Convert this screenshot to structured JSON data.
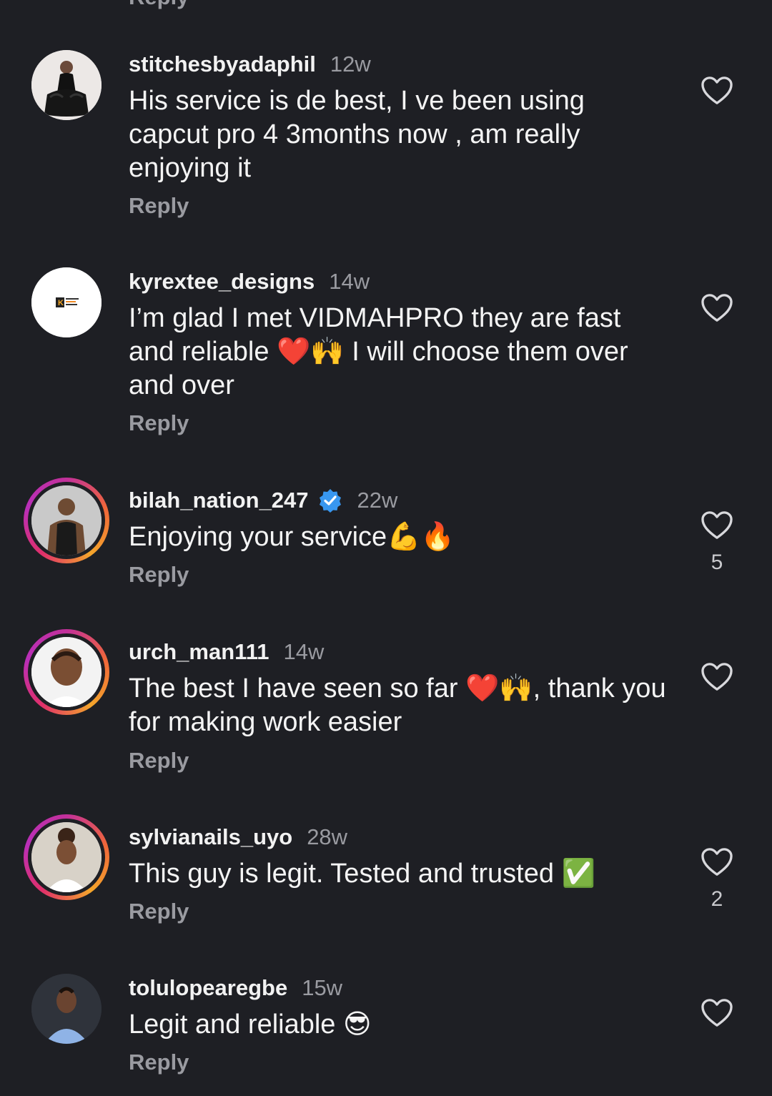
{
  "partial_reply": "Reply",
  "comments": [
    {
      "username": "stitchesbyadaphil",
      "time": "12w",
      "text": "His service is de best, I ve been using capcut pro 4 3months now , am really enjoying it",
      "reply": "Reply",
      "likes": "",
      "avatar": "woman-in-black-dress-avatar",
      "ring": false,
      "verified": false
    },
    {
      "username": "kyrextee_designs",
      "time": "14w",
      "text": "I’m glad I met VIDMAHPRO they are fast and reliable ❤️🙌 I will choose them over and over",
      "reply": "Reply",
      "likes": "",
      "avatar": "k-logo-avatar",
      "ring": false,
      "verified": false
    },
    {
      "username": "bilah_nation_247",
      "time": "22w",
      "text": "Enjoying your service💪🔥",
      "reply": "Reply",
      "likes": "5",
      "avatar": "man-in-black-tank-top-avatar",
      "ring": true,
      "verified": true
    },
    {
      "username": "urch_man111",
      "time": "14w",
      "text": "The best I have seen so far ❤️🙌, thank you for making work easier",
      "reply": "Reply",
      "likes": "",
      "avatar": "man-portrait-avatar",
      "ring": true,
      "verified": false
    },
    {
      "username": "sylvianails_uyo",
      "time": "28w",
      "text": "This guy is legit. Tested and trusted ✅",
      "reply": "Reply",
      "likes": "2",
      "avatar": "woman-portrait-avatar",
      "ring": true,
      "verified": false
    },
    {
      "username": "tolulopearegbe",
      "time": "15w",
      "text": "Legit and reliable 😎",
      "reply": "Reply",
      "likes": "",
      "avatar": "man-in-blue-shirt-avatar",
      "ring": false,
      "verified": false
    }
  ],
  "colors": {
    "background": "#1e1f24",
    "text": "#f4f4f4",
    "muted": "#9a9ba1",
    "verified": "#3897f0"
  }
}
